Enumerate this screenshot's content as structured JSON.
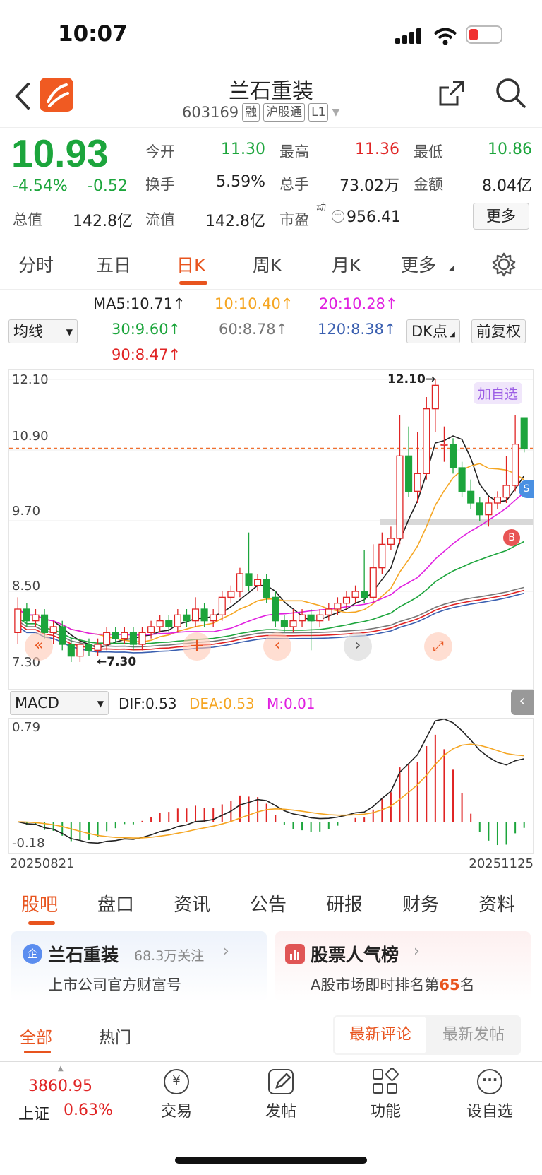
{
  "status_bar": {
    "time": "10:07"
  },
  "header": {
    "title": "兰石重装",
    "code": "603169",
    "tags": [
      "融",
      "沪股通",
      "L1"
    ]
  },
  "quote": {
    "price": "10.93",
    "change_pct": "-4.54%",
    "change": "-0.52",
    "stats": [
      {
        "label": "今开",
        "value": "11.30"
      },
      {
        "label": "最高",
        "value": "11.36"
      },
      {
        "label": "最低",
        "value": "10.86"
      },
      {
        "label": "换手",
        "value": "5.59%"
      },
      {
        "label": "总手",
        "value": "73.02万"
      },
      {
        "label": "金额",
        "value": "8.04亿"
      },
      {
        "label": "总值",
        "value": "142.8亿"
      },
      {
        "label": "流值",
        "value": "142.8亿"
      },
      {
        "label": "市盈",
        "value": "956.41"
      }
    ],
    "pe_super": "动",
    "more_label": "更多"
  },
  "kline_tabs": [
    "分时",
    "五日",
    "日K",
    "周K",
    "月K",
    "更多"
  ],
  "indicators": {
    "selector": "均线",
    "ma5": "MA5:10.71↑",
    "ma10": "10:10.40↑",
    "ma20": "20:10.28↑",
    "ma30": "30:9.60↑",
    "ma60": "60:8.78↑",
    "ma120": "120:8.38↑",
    "ma90": "90:8.47↑",
    "dk_label": "DK点",
    "adjust_label": "前复权"
  },
  "chart_data": {
    "type": "candlestick",
    "yticks": [
      "12.10",
      "10.90",
      "9.70",
      "8.50",
      "7.30"
    ],
    "ylim": [
      7.3,
      12.1
    ],
    "max_label": "12.10→",
    "min_label": "←7.30",
    "add_watch": "加自选",
    "marker_buy": "B",
    "marker_sell": "S",
    "current_price": 10.93,
    "candles": [
      [
        7.8,
        8.2,
        7.6,
        8.4
      ],
      [
        8.2,
        8.0,
        7.9,
        8.3
      ],
      [
        8.0,
        8.1,
        7.9,
        8.2
      ],
      [
        8.1,
        7.8,
        7.7,
        8.2
      ],
      [
        7.8,
        7.9,
        7.6,
        8.0
      ],
      [
        7.9,
        7.6,
        7.5,
        8.0
      ],
      [
        7.6,
        7.4,
        7.3,
        7.7
      ],
      [
        7.4,
        7.6,
        7.3,
        7.7
      ],
      [
        7.6,
        7.5,
        7.4,
        7.7
      ],
      [
        7.5,
        7.6,
        7.4,
        7.7
      ],
      [
        7.6,
        7.8,
        7.5,
        7.9
      ],
      [
        7.8,
        7.7,
        7.6,
        7.9
      ],
      [
        7.7,
        7.8,
        7.6,
        7.9
      ],
      [
        7.8,
        7.6,
        7.5,
        7.9
      ],
      [
        7.6,
        7.8,
        7.5,
        7.9
      ],
      [
        7.8,
        7.9,
        7.7,
        8.0
      ],
      [
        7.9,
        8.0,
        7.8,
        8.1
      ],
      [
        8.0,
        7.9,
        7.8,
        8.1
      ],
      [
        7.9,
        8.1,
        7.8,
        8.2
      ],
      [
        8.1,
        8.0,
        7.9,
        8.2
      ],
      [
        8.0,
        8.2,
        7.9,
        8.4
      ],
      [
        8.2,
        8.0,
        7.9,
        8.3
      ],
      [
        8.0,
        8.1,
        7.9,
        8.2
      ],
      [
        8.1,
        8.4,
        8.0,
        8.5
      ],
      [
        8.4,
        8.5,
        8.3,
        8.6
      ],
      [
        8.5,
        8.8,
        8.4,
        8.9
      ],
      [
        8.8,
        8.6,
        8.5,
        9.5
      ],
      [
        8.6,
        8.7,
        8.5,
        8.8
      ],
      [
        8.7,
        8.4,
        8.3,
        8.8
      ],
      [
        8.4,
        8.0,
        7.9,
        8.5
      ],
      [
        8.0,
        7.9,
        7.8,
        8.1
      ],
      [
        7.9,
        8.0,
        7.8,
        8.2
      ],
      [
        8.0,
        8.1,
        7.9,
        8.2
      ],
      [
        8.1,
        8.0,
        7.5,
        8.2
      ],
      [
        8.0,
        8.1,
        7.9,
        8.2
      ],
      [
        8.1,
        8.2,
        8.0,
        8.3
      ],
      [
        8.2,
        8.3,
        8.1,
        8.4
      ],
      [
        8.3,
        8.4,
        8.2,
        8.5
      ],
      [
        8.4,
        8.5,
        8.3,
        8.6
      ],
      [
        8.5,
        8.4,
        8.3,
        9.2
      ],
      [
        8.4,
        8.9,
        8.3,
        9.3
      ],
      [
        8.9,
        9.3,
        8.8,
        9.5
      ],
      [
        9.3,
        9.4,
        9.2,
        9.6
      ],
      [
        9.4,
        10.8,
        9.3,
        11.5
      ],
      [
        10.8,
        10.2,
        10.1,
        11.3
      ],
      [
        10.2,
        10.5,
        10.0,
        11.2
      ],
      [
        10.5,
        11.6,
        10.4,
        11.8
      ],
      [
        11.6,
        12.0,
        11.2,
        12.1
      ],
      [
        11.0,
        11.0,
        10.7,
        11.3
      ],
      [
        11.0,
        10.6,
        10.5,
        11.1
      ],
      [
        10.6,
        10.2,
        10.1,
        10.7
      ],
      [
        10.2,
        10.0,
        9.9,
        10.4
      ],
      [
        10.0,
        9.8,
        9.7,
        10.1
      ],
      [
        9.8,
        10.0,
        9.6,
        10.1
      ],
      [
        10.0,
        10.1,
        9.9,
        10.2
      ],
      [
        10.1,
        10.3,
        10.0,
        10.8
      ],
      [
        10.3,
        11.0,
        10.2,
        11.5
      ],
      [
        11.45,
        10.93,
        10.86,
        11.36
      ]
    ],
    "macd_yticks": [
      "0.79",
      "-0.18"
    ],
    "dates": [
      "20250821",
      "20251125"
    ]
  },
  "macd": {
    "selector": "MACD",
    "dif": "DIF:0.53",
    "dea": "DEA:0.53",
    "m": "M:0.01"
  },
  "section_tabs": [
    "股吧",
    "盘口",
    "资讯",
    "公告",
    "研报",
    "财务",
    "资料"
  ],
  "cards": [
    {
      "title": "兰石重装",
      "meta": "68.3万关注",
      "sub": "上市公司官方财富号"
    },
    {
      "title": "股票人气榜",
      "sub_prefix": "A股市场即时排名第",
      "rank": "65",
      "sub_suffix": "名"
    }
  ],
  "feed": {
    "filters": [
      "全部",
      "热门"
    ],
    "sort": [
      "最新评论",
      "最新发帖"
    ]
  },
  "index_widget": {
    "value": "3860.95",
    "name": "上证",
    "pct": "0.63%"
  },
  "bottom_nav": [
    "交易",
    "发帖",
    "功能",
    "设自选"
  ]
}
